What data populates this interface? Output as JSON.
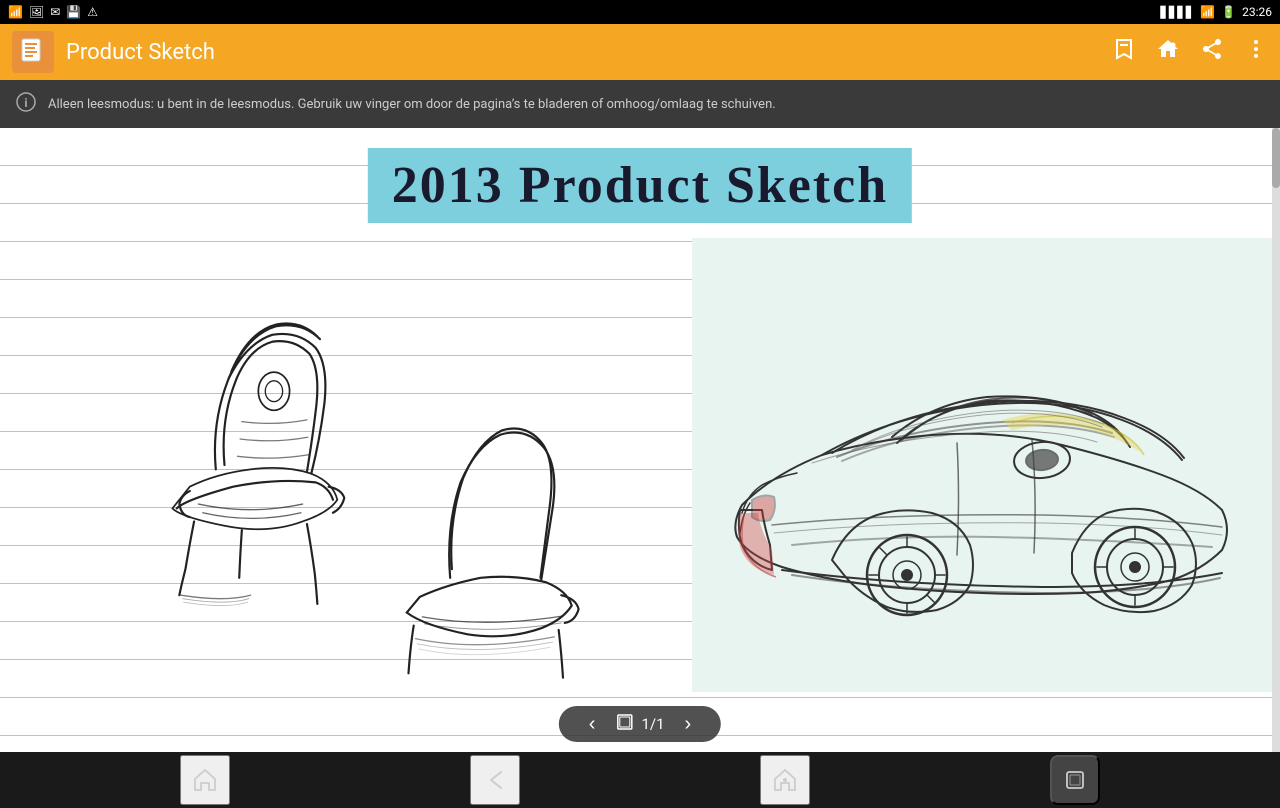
{
  "status_bar": {
    "time": "23:26",
    "icons": [
      "signal",
      "wifi",
      "battery"
    ]
  },
  "toolbar": {
    "title": "Product Sketch",
    "icon_label": "doc-icon",
    "action_icons": [
      "bookmark-icon",
      "home-share-icon",
      "share-icon",
      "more-icon"
    ]
  },
  "info_bar": {
    "message": "Alleen leesmodus: u bent in de leesmodus. Gebruik uw vinger om door de pagina’s te bladeren of omhoog/omlaag te schuiven."
  },
  "page_title": "2013 Product Sketch",
  "page_nav": {
    "prev_label": "‹",
    "next_label": "›",
    "page_info": "1/1",
    "page_icon": "⎘"
  },
  "bottom_bar": {
    "buttons": [
      "home-outline-icon",
      "back-icon",
      "home-icon",
      "recents-icon"
    ]
  }
}
